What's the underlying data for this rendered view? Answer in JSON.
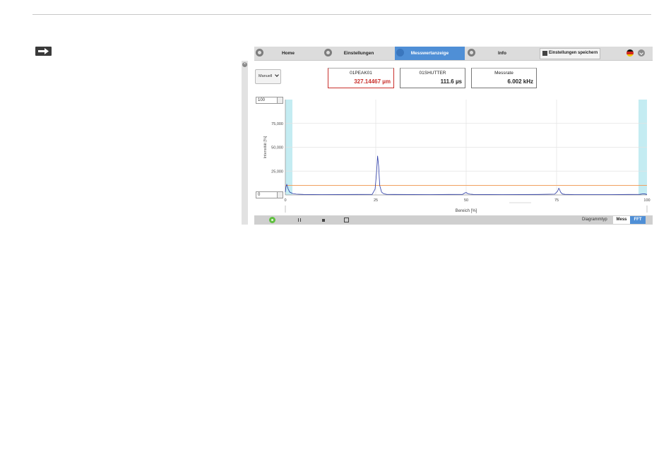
{
  "app": {
    "nav": [
      {
        "label": "Home",
        "icon": "home-icon"
      },
      {
        "label": "Einstellungen",
        "icon": "settings-icon"
      },
      {
        "label": "Messwertanzeige",
        "icon": "signal-icon",
        "active": true
      },
      {
        "label": "Info",
        "icon": "info-icon"
      }
    ],
    "save_label": "Einstellungen speichern",
    "language_flag": "german-flag-icon",
    "mode_select": {
      "value": "Manuell"
    },
    "measure_boxes": [
      {
        "title": "01PEAK01",
        "value": "327.14467 µm",
        "color": "#c9302c"
      },
      {
        "title": "01SHUTTER",
        "value": "111.6 µs"
      },
      {
        "title": "Messrate",
        "value": "6.002 kHz"
      }
    ],
    "footer": {
      "diagram_type_label": "Diagrammtyp",
      "seg_mess": "Mess",
      "seg_fft": "FFT"
    }
  },
  "chart_data": {
    "type": "line",
    "xlabel": "Bereich [%]",
    "ylabel": "Intensität [%]",
    "xlim": [
      0,
      100
    ],
    "ylim": [
      0,
      100
    ],
    "x_ticks": [
      "0",
      "25",
      "50",
      "75",
      "100"
    ],
    "y_ticks": [
      "25,000",
      "50,000",
      "75,000"
    ],
    "y_spin_top": "100",
    "y_spin_bottom": "0",
    "threshold": 10,
    "colors": {
      "line": "#2a3aa8",
      "threshold": "#f0a060",
      "masked": "#c4ecf2"
    },
    "series": [
      {
        "x": [
          0,
          0.2,
          0.4,
          0.8,
          1.2,
          2,
          3,
          5,
          10,
          20,
          24,
          24.8,
          25.2,
          25.5,
          25.8,
          26.1,
          26.6,
          27.2,
          28,
          30,
          40,
          49,
          49.6,
          50,
          50.4,
          51,
          52,
          60,
          70,
          74.5,
          75.3,
          75.6,
          75.8,
          76.1,
          76.6,
          77.3,
          80,
          90,
          98,
          99,
          99.5,
          100
        ],
        "y": [
          3,
          9,
          11,
          6,
          3,
          1.5,
          0.8,
          0.5,
          0.4,
          0.5,
          0.6,
          6,
          22,
          41,
          30,
          10,
          3,
          1.2,
          0.6,
          0.5,
          0.4,
          0.6,
          2,
          2.5,
          1.5,
          0.8,
          0.5,
          0.4,
          0.5,
          0.8,
          4,
          7,
          6,
          3,
          1,
          0.6,
          0.4,
          0.4,
          0.6,
          1.2,
          1,
          0.5
        ]
      }
    ]
  }
}
